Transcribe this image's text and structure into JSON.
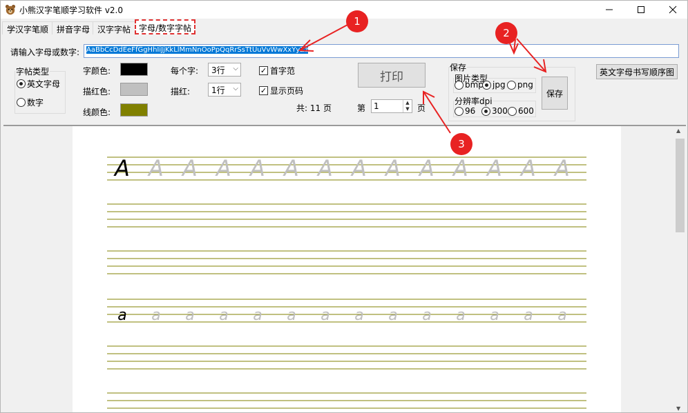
{
  "window": {
    "title": "小熊汉字笔顺学习软件 v2.0",
    "minimize": "—",
    "maximize": "☐",
    "close": "✕"
  },
  "tabs": [
    {
      "label": "学汉字笔顺"
    },
    {
      "label": "拼音字母"
    },
    {
      "label": "汉字字帖"
    },
    {
      "label": "字母/数字字帖"
    }
  ],
  "input": {
    "label": "请输入字母或数字:",
    "value": "AaBbCcDdEeFfGgHhIiJjKkLlMmNnOoPpQqRrSsTtUuVvWwXxYyZz"
  },
  "type_group": {
    "legend": "字帖类型",
    "options": [
      "英文字母",
      "数字"
    ],
    "selected": 0
  },
  "colors": {
    "char_label": "字颜色:",
    "trace_label": "描红色:",
    "line_label": "线颜色:",
    "char": "#000000",
    "trace": "#c0c0c0",
    "line": "#808000",
    "accent": "#e82222"
  },
  "per_char": {
    "label": "每个字:",
    "value": "3行"
  },
  "trace_rows": {
    "label": "描红:",
    "value": "1行"
  },
  "checks": [
    {
      "label": "首字范",
      "checked": true
    },
    {
      "label": "显示页码",
      "checked": true
    }
  ],
  "print_button": "打印",
  "total": "共: 11 页",
  "page_nav": {
    "prefix": "第",
    "value": "1",
    "suffix": "页"
  },
  "save_group": {
    "legend": "保存",
    "img_type": {
      "legend": "图片类型",
      "options": [
        "bmp",
        "jpg",
        "png"
      ],
      "selected": 1
    },
    "dpi": {
      "legend": "分辨率dpi",
      "options": [
        "96",
        "300",
        "600"
      ],
      "selected": 1
    },
    "save_button": "保存"
  },
  "order_button": "英文字母书写顺序图",
  "markers": [
    "1",
    "2",
    "3"
  ],
  "preview": {
    "row1_char": "A",
    "row2_char": "a"
  }
}
